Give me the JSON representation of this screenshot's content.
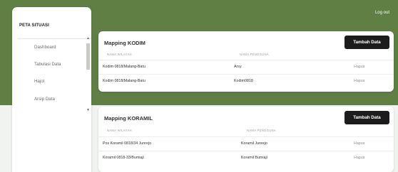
{
  "header": {
    "logout_label": "Log out"
  },
  "sidebar": {
    "brand": "PETA SITUASI",
    "items": [
      {
        "label": "Dashboard"
      },
      {
        "label": "Tabulasi Data"
      },
      {
        "label": "Hajol"
      },
      {
        "label": "Arsip Data"
      }
    ]
  },
  "kodim": {
    "title": "Mapping KODIM",
    "add_label": "Tambah Data",
    "columns": [
      "NAMA WILAYAH",
      "NAMA PENGGUNA"
    ],
    "rows": [
      {
        "wilayah": "Kodim 0818/Malang-Batu",
        "pengguna": "Arsy",
        "action": "Hapus"
      },
      {
        "wilayah": "Kodim 0818/Malang-Batu",
        "pengguna": "Kodim0818",
        "action": "Hapus"
      }
    ]
  },
  "koramil": {
    "title": "Mapping KORAMIL",
    "add_label": "Tambah Data",
    "columns": [
      "NAMA WILAYAH",
      "NAMA PENGGUNA"
    ],
    "rows": [
      {
        "wilayah": "Pos Koramil 0818/34 Junrejo",
        "pengguna": "Koramil Junrejo",
        "action": "Hapus"
      },
      {
        "wilayah": "Koramil 0818-33/Bumiaji",
        "pengguna": "Koramil Bumiaji",
        "action": "Hapus"
      }
    ]
  },
  "colors": {
    "header_green": "#5f7f45",
    "button_dark": "#1c1c1c"
  }
}
